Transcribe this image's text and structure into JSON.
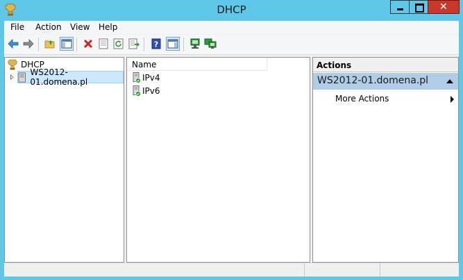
{
  "window": {
    "title": "DHCP"
  },
  "menu": {
    "items": [
      "File",
      "Action",
      "View",
      "Help"
    ]
  },
  "toolbar": {
    "buttons": [
      "back-icon",
      "forward-icon",
      "up-folder-icon",
      "show-hide-console-tree-icon",
      "delete-icon",
      "properties-icon",
      "refresh-icon",
      "export-list-icon",
      "help-icon",
      "show-hide-action-pane-icon",
      "server-icon-1",
      "server-icon-2"
    ]
  },
  "tree": {
    "root": {
      "label": "DHCP",
      "icon": "dhcp-trophy-icon"
    },
    "nodes": [
      {
        "label": "WS2012-01.domena.pl",
        "icon": "server-tower-icon",
        "selected": true,
        "collapsed": true
      }
    ]
  },
  "list": {
    "header": {
      "name": "Name"
    },
    "rows": [
      {
        "label": "IPv4",
        "icon": "ip-server-icon"
      },
      {
        "label": "IPv6",
        "icon": "ip-server-icon"
      }
    ]
  },
  "actions": {
    "title": "Actions",
    "group": {
      "label": "WS2012-01.domena.pl"
    },
    "items": [
      {
        "label": "More Actions",
        "submenu": true
      }
    ]
  },
  "colors": {
    "titlebar": "#5fc8e9",
    "close": "#c7392b",
    "selection": "#cce8ff",
    "action_group": "#b0cde8"
  }
}
